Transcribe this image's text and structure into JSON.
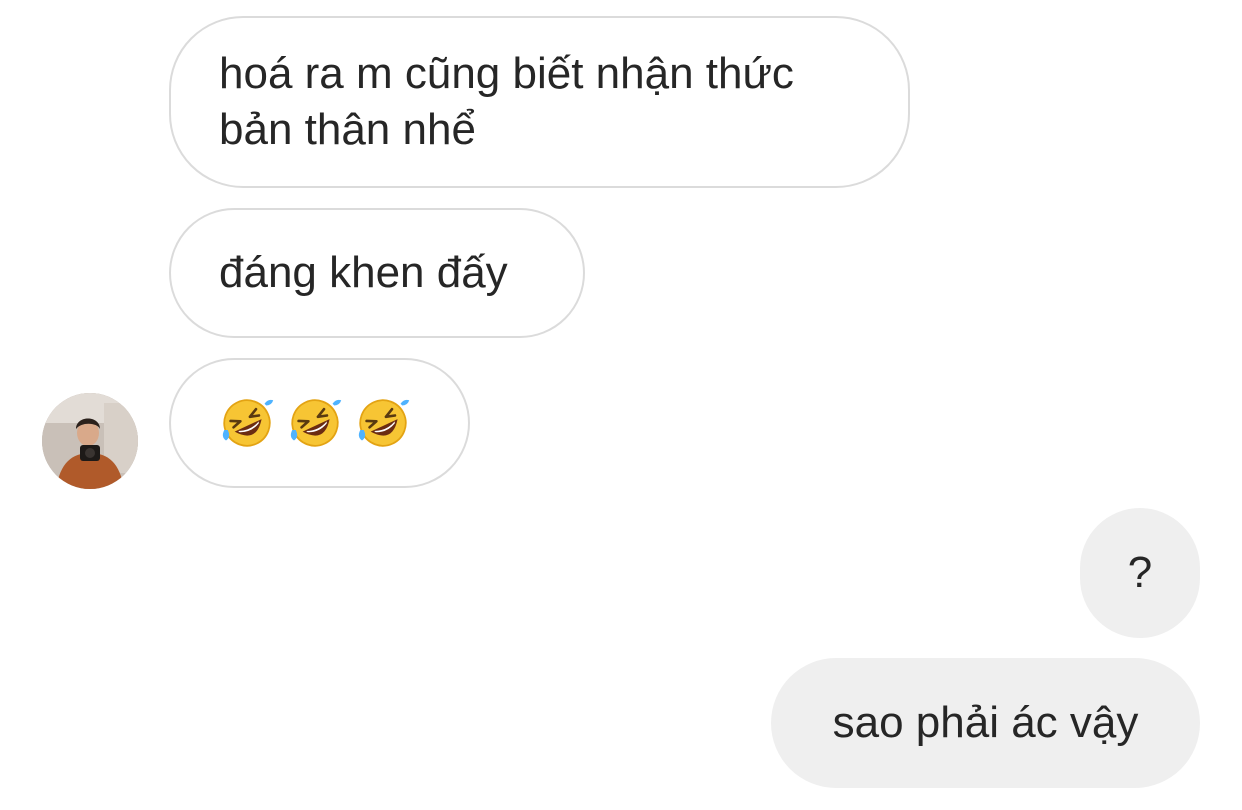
{
  "thread": {
    "incoming": [
      {
        "text": "hoá ra m cũng biết nhận thức\nbản thân nhể"
      },
      {
        "text": "đáng khen đấy"
      },
      {
        "emoji": [
          "rolling-on-floor-laughing",
          "rolling-on-floor-laughing",
          "rolling-on-floor-laughing"
        ]
      }
    ],
    "outgoing": [
      {
        "text": "?"
      },
      {
        "text": "sao phải ác vậy"
      }
    ]
  },
  "contact": {
    "avatar_icon": "user-avatar-photo"
  },
  "colors": {
    "incoming_border": "#dbdbdb",
    "outgoing_bg": "#efefef",
    "text": "#262626"
  }
}
